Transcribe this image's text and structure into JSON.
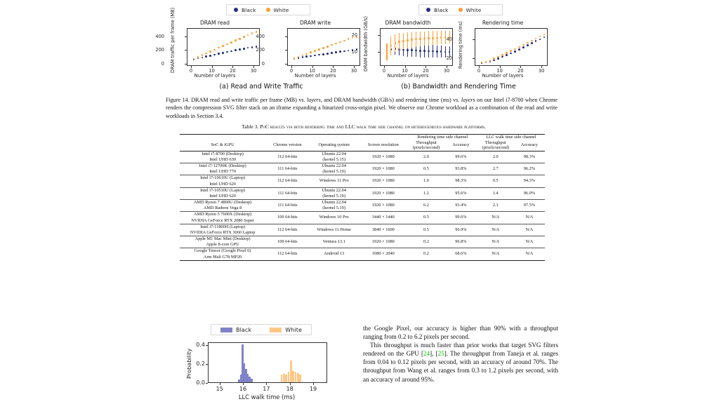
{
  "figure": {
    "legend": {
      "black": "Black",
      "white": "White"
    },
    "colors": {
      "black": "#27307f",
      "white": "#ff9d2e",
      "hist_black": "#8082c8",
      "hist_white": "#ffc785"
    },
    "subcaptions": {
      "a": "(a) Read and Write Traffic",
      "b": "(b) Bandwidth and Rendering Time"
    },
    "caption_label": "Figure 14.",
    "caption_text_1": " DRAM read and write traffic per frame (MB) vs. ",
    "caption_em_1": "layers",
    "caption_text_2": ", and DRAM bandwidth (GB/s) and rendering time (ms) vs. ",
    "caption_em_2": "layers",
    "caption_text_3": " on our Intel i7-8700 when Chrome renders the compression SVG filter stack on an iframe expanding a binarized cross-origin pixel. We observe our Chrome workload as a combination of the read and write workloads in Section 3.4."
  },
  "chart_data": [
    {
      "type": "scatter",
      "title": "DRAM read",
      "xlabel": "Number of layers",
      "ylabel": "DRAM traffic per frame (MB)",
      "xlim": [
        -2,
        33
      ],
      "ylim": [
        -30,
        520
      ],
      "xticks": [
        0,
        10,
        20,
        30
      ],
      "yticks": [
        0,
        200,
        400
      ],
      "x": [
        1,
        3,
        5,
        7,
        9,
        11,
        13,
        15,
        17,
        19,
        21,
        23,
        25,
        27,
        29,
        31
      ],
      "series": [
        {
          "name": "Black",
          "values": [
            78,
            92,
            104,
            118,
            130,
            144,
            158,
            170,
            183,
            196,
            208,
            221,
            232,
            243,
            252,
            262
          ]
        },
        {
          "name": "White",
          "values": [
            84,
            110,
            137,
            163,
            190,
            216,
            243,
            270,
            296,
            322,
            349,
            375,
            402,
            428,
            452,
            474
          ]
        }
      ]
    },
    {
      "type": "scatter",
      "title": "DRAM write",
      "xlabel": "Number of layers",
      "ylabel": "",
      "xlim": [
        -2,
        33
      ],
      "ylim": [
        -30,
        520
      ],
      "xticks": [
        0,
        10,
        20,
        30
      ],
      "yticks": [
        0,
        200,
        400
      ],
      "x": [
        1,
        3,
        5,
        7,
        9,
        11,
        13,
        15,
        17,
        19,
        21,
        23,
        25,
        27,
        29,
        31
      ],
      "series": [
        {
          "name": "Black",
          "values": [
            86,
            96,
            105,
            115,
            124,
            133,
            142,
            151,
            160,
            169,
            178,
            187,
            196,
            204,
            212,
            219
          ]
        },
        {
          "name": "White",
          "values": [
            90,
            111,
            133,
            154,
            176,
            198,
            219,
            241,
            262,
            284,
            305,
            327,
            348,
            370,
            388,
            403
          ]
        }
      ]
    },
    {
      "type": "scatter",
      "title": "DRAM bandwidth",
      "xlabel": "Number of layers",
      "ylabel": "DRAM bandwidth (GB/s)",
      "xlim": [
        -2,
        33
      ],
      "ylim": [
        2,
        24
      ],
      "xticks": [
        0,
        10,
        20,
        30
      ],
      "yticks": [
        10,
        20
      ],
      "x": [
        1,
        3,
        5,
        7,
        9,
        11,
        13,
        15,
        17,
        19,
        21,
        23,
        25,
        27,
        29,
        31
      ],
      "series": [
        {
          "name": "Black",
          "values": [
            10.2,
            12.1,
            12.4,
            12.0,
            11.8,
            11.6,
            11.5,
            11.4,
            11.2,
            11.1,
            11.0,
            10.9,
            10.8,
            10.7,
            10.6,
            10.6
          ],
          "errors": [
            1.3,
            3.0,
            3.5,
            3.6,
            3.7,
            3.7,
            3.8,
            3.8,
            3.8,
            3.8,
            3.8,
            3.7,
            3.6,
            3.5,
            3.4,
            3.3
          ]
        },
        {
          "name": "White",
          "values": [
            10.5,
            14.2,
            15.6,
            16.4,
            16.9,
            17.3,
            17.6,
            17.9,
            18.1,
            18.3,
            18.5,
            18.6,
            18.7,
            18.8,
            18.9,
            19.0
          ],
          "errors": [
            5.0,
            5.5,
            5.2,
            5.0,
            4.8,
            4.6,
            4.5,
            4.4,
            4.3,
            4.2,
            4.1,
            4.0,
            3.9,
            3.8,
            3.7,
            3.6
          ]
        }
      ]
    },
    {
      "type": "scatter",
      "title": "Rendering time",
      "xlabel": "Number of layers",
      "ylabel": "Rendering time (ms)",
      "xlim": [
        -2,
        33
      ],
      "ylim": [
        12,
        52
      ],
      "xticks": [
        0,
        10,
        20,
        30
      ],
      "yticks": [
        20,
        40
      ],
      "x": [
        1,
        3,
        5,
        7,
        9,
        11,
        13,
        15,
        17,
        19,
        21,
        23,
        25,
        27,
        29,
        31
      ],
      "series": [
        {
          "name": "Black",
          "values": [
            16.2,
            16.4,
            17.2,
            18.8,
            20.5,
            22.3,
            24.1,
            26.0,
            28.0,
            30.2,
            32.4,
            34.6,
            36.8,
            39.0,
            41.0,
            43.0
          ]
        },
        {
          "name": "White",
          "values": [
            16.4,
            16.8,
            18.4,
            20.4,
            22.4,
            24.4,
            26.4,
            28.5,
            30.6,
            32.8,
            35.0,
            37.2,
            39.4,
            41.6,
            43.8,
            46.0
          ]
        }
      ]
    },
    {
      "type": "bar",
      "title": "",
      "xlabel": "LLC walk time (ms)",
      "ylabel": "Probability",
      "xlim": [
        14.5,
        19.6
      ],
      "ylim": [
        0,
        0.43
      ],
      "xticks": [
        15,
        16,
        17,
        18,
        19
      ],
      "yticks": [
        0.0,
        0.2,
        0.4
      ],
      "ytick_labels": [
        "0.0",
        "0.2",
        "0.4"
      ],
      "series": [
        {
          "name": "Black",
          "x": [
            15.8,
            15.88,
            15.96,
            16.02,
            16.1,
            16.18,
            16.26,
            16.34
          ],
          "values": [
            0.03,
            0.08,
            0.4,
            0.2,
            0.14,
            0.09,
            0.06,
            0.04
          ]
        },
        {
          "name": "White",
          "x": [
            17.62,
            17.72,
            17.82,
            17.92,
            18.02,
            18.12,
            18.22,
            18.32,
            18.42
          ],
          "values": [
            0.08,
            0.09,
            0.08,
            0.11,
            0.23,
            0.12,
            0.11,
            0.1,
            0.08
          ]
        }
      ]
    }
  ],
  "table": {
    "caption_label": "Table 3.",
    "caption_text": "PoC results via both rendering time and LLC walk time side channel on heterogeneous hardware platforms.",
    "group_headers": [
      {
        "label": "Rendering time side channel"
      },
      {
        "label": "LLC walk time side channel"
      }
    ],
    "columns": [
      "SoC & iGPU",
      "Chrome version",
      "Operating system",
      "Screen resolution",
      "Throughput\n(pixels/second)",
      "Accuracy",
      "Throughput\n(pixels/second)",
      "Accuracy"
    ],
    "sub_headers": {
      "throughput_line1": "Throughput",
      "throughput_line2": "(pixels/second)",
      "accuracy": "Accuracy"
    },
    "rows": [
      {
        "soc_line1": "Intel i7-8700 (Desktop)",
        "soc_line2": "Intel UHD 630",
        "chrome": "112 64-bits",
        "os_line1": "Ubuntu 22.04",
        "os_line2": "(kernel 5.15)",
        "resolution": "1920 × 1080",
        "rt_throughput": "2.0",
        "rt_accuracy": "99.6%",
        "llc_throughput": "2.0",
        "llc_accuracy": "98.3%"
      },
      {
        "soc_line1": "Intel i7-12700K (Desktop)",
        "soc_line2": "Intel UHD 770",
        "chrome": "111 64-bits",
        "os_line1": "Ubuntu 22.04",
        "os_line2": "(kernel 5.19)",
        "resolution": "1920 × 1080",
        "rt_throughput": "0.5",
        "rt_accuracy": "93.8%",
        "llc_throughput": "2.7",
        "llc_accuracy": "96.2%"
      },
      {
        "soc_line1": "Intel i7-10610U (Laptop)",
        "soc_line2": "Intel UHD 620",
        "chrome": "112 64-bits",
        "os_line1": "Windows 11 Pro",
        "os_line2": "",
        "resolution": "1920 × 1080",
        "rt_throughput": "1.0",
        "rt_accuracy": "98.3%",
        "llc_throughput": "0.5",
        "llc_accuracy": "94.3%"
      },
      {
        "soc_line1": "Intel i7-10510U (Laptop)",
        "soc_line2": "Intel UHD 620",
        "chrome": "111 64-bits",
        "os_line1": "Ubuntu 22.04",
        "os_line2": "(kernel 5.19)",
        "resolution": "1920 × 1080",
        "rt_throughput": "1.2",
        "rt_accuracy": "95.6%",
        "llc_throughput": "1.4",
        "llc_accuracy": "96.9%"
      },
      {
        "soc_line1": "AMD Ryzen 7 4800U (Desktop)",
        "soc_line2": "AMD Radeon Vega 8",
        "chrome": "111 64-bits",
        "os_line1": "Ubuntu 22.04",
        "os_line2": "(kernel 5.19)",
        "resolution": "1920 × 1080",
        "rt_throughput": "6.2",
        "rt_accuracy": "93.4%",
        "llc_throughput": "2.1",
        "llc_accuracy": "97.5%"
      },
      {
        "soc_line1": "AMD Ryzen 5 7600X (Desktop)",
        "soc_line2": "NVIDIA GeForce RTX 2080 Super",
        "chrome": "109 64-bits",
        "os_line1": "Windows 10 Pro",
        "os_line2": "",
        "resolution": "3440 × 1440",
        "rt_throughput": "0.5",
        "rt_accuracy": "99.6%",
        "llc_throughput": "N/A",
        "llc_accuracy": "N/A"
      },
      {
        "soc_line1": "Intel i7-11800H (Laptop)",
        "soc_line2": "NVIDIA GeForce RTX 3060 Laptop",
        "chrome": "112 64-bits",
        "os_line1": "Windows 11 Home",
        "os_line2": "",
        "resolution": "3840 × 1600",
        "rt_throughput": "0.5",
        "rt_accuracy": "96.9%",
        "llc_throughput": "N/A",
        "llc_accuracy": "N/A"
      },
      {
        "soc_line1": "Apple M1 Mac Mini (Desktop)",
        "soc_line2": "Apple 8-core GPU",
        "chrome": "109 64-bits",
        "os_line1": "Ventura 13.1",
        "os_line2": "",
        "resolution": "1920 × 1080",
        "rt_throughput": "0.2",
        "rt_accuracy": "96.8%",
        "llc_throughput": "N/A",
        "llc_accuracy": "N/A"
      },
      {
        "soc_line1": "Google Tensor (Google Pixel 6)",
        "soc_line2": "Arm Mali G78 MP20",
        "chrome": "112 64-bits",
        "os_line1": "Android 13",
        "os_line2": "",
        "resolution": "1080 × 2040",
        "rt_throughput": "0.2",
        "rt_accuracy": "68.6%",
        "llc_throughput": "N/A",
        "llc_accuracy": "N/A"
      }
    ]
  },
  "body_text": {
    "para1": "the Google Pixel, our accuracy is higher than 90% with a throughput ranging from 0.2 to 6.2 pixels per second.",
    "para2_part1": "This throughput is much faster than prior works that target SVG filters rendered on the GPU [",
    "cite1": "24",
    "para2_part2": "], [",
    "cite2": "25",
    "para2_part3": "]. The throughput from Taneja et al. ranges from 0.04 to 0.12 pixels per second, with an accuracy of around 70%. The throughput from Wang et al. ranges from 0.3 to 1.2 pixels per second, with an accuracy of around 95%."
  }
}
